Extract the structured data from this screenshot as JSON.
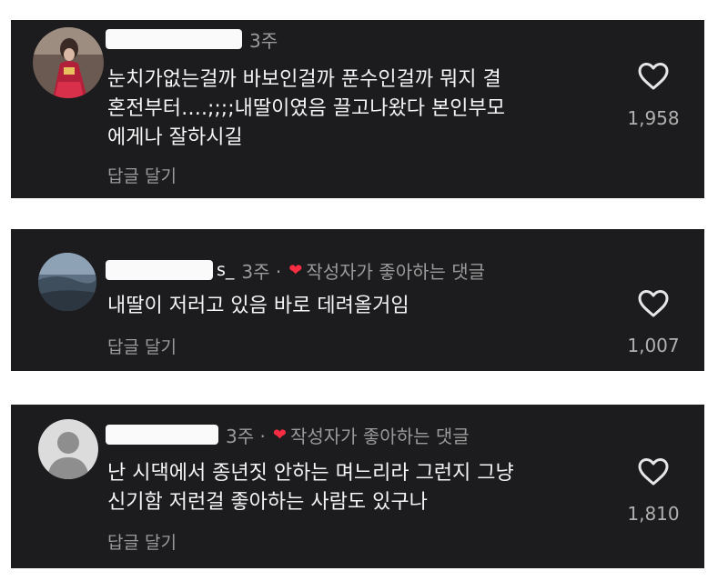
{
  "comments": [
    {
      "time": "3주",
      "text": "눈치가없는걸까 바보인걸까 푼수인걸까 뭐지 결\n혼전부터….;;;;내딸이였음 끌고나왔다 본인부모\n에게나 잘하시길",
      "reply_label": "답글 달기",
      "likes": "1,958",
      "liked_by_author": false
    },
    {
      "username_tail": "s_",
      "time": "3주 ·",
      "author_liked_label": "작성자가 좋아하는 댓글",
      "text": "내딸이 저러고 있음 바로 데려올거임",
      "reply_label": "답글 달기",
      "likes": "1,007",
      "liked_by_author": true
    },
    {
      "time": "3주 ·",
      "author_liked_label": "작성자가 좋아하는 댓글",
      "text": "난 시댁에서 종년짓 안하는 며느리라 그런지 그냥\n신기함 저런걸 좋아하는 사람도 있구나",
      "reply_label": "답글 달기",
      "likes": "1,810",
      "liked_by_author": true
    }
  ],
  "colors": {
    "card_bg": "#1c1c1e",
    "text": "#f5f5f5",
    "muted": "#9a9a9a",
    "heart_red": "#ff2d44"
  },
  "icons": [
    "heart-outline-icon",
    "heart-filled-icon",
    "avatar-photo",
    "default-avatar-icon"
  ]
}
